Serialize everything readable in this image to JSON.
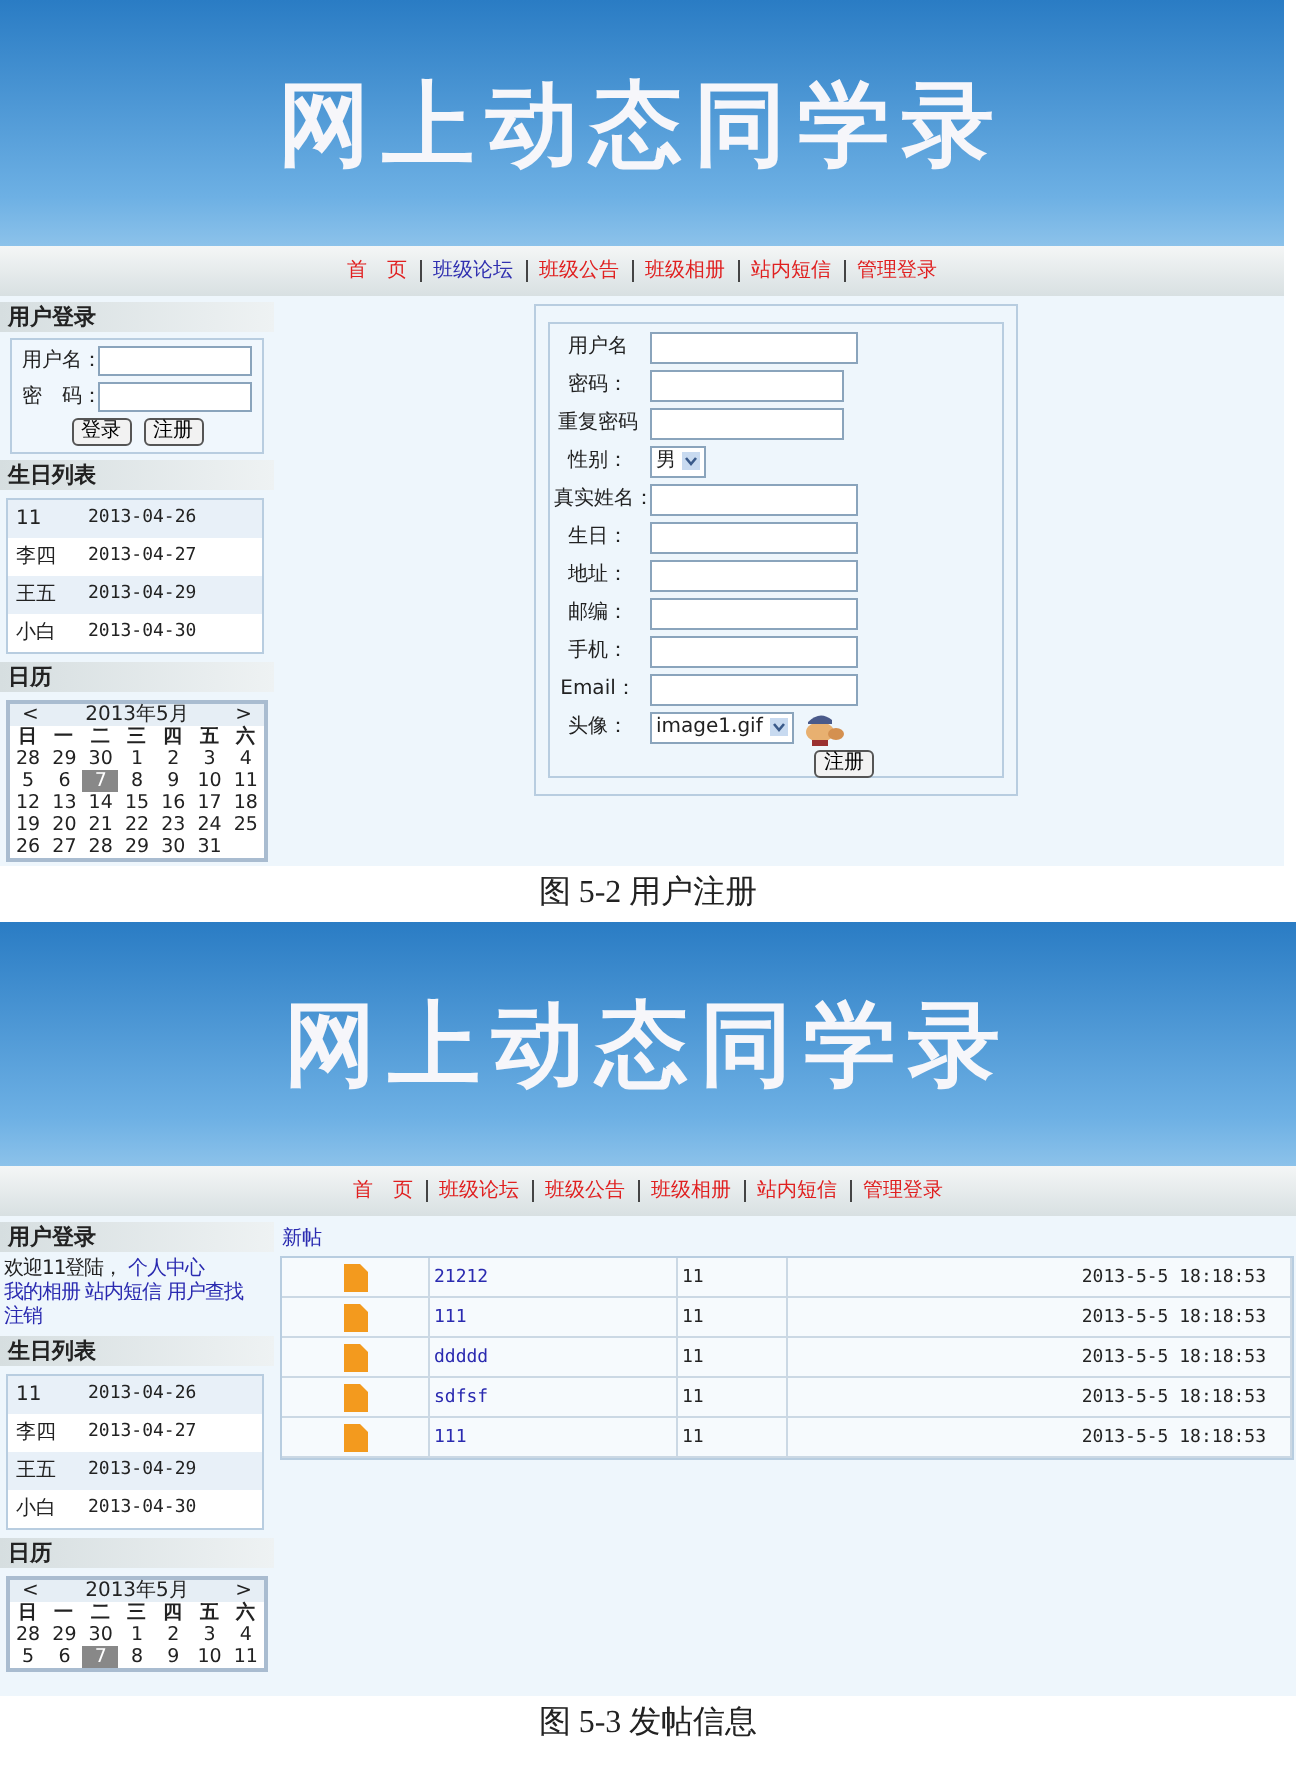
{
  "figures": [
    {
      "screenshot": {
        "banner_title": "网上动态同学录",
        "nav": [
          {
            "label": "首　页",
            "color": "#e02020"
          },
          {
            "label": "班级论坛",
            "color": "#3030b0"
          },
          {
            "label": "班级公告",
            "color": "#e02020"
          },
          {
            "label": "班级相册",
            "color": "#e02020"
          },
          {
            "label": "站内短信",
            "color": "#e02020"
          },
          {
            "label": "管理登录",
            "color": "#e02020"
          }
        ],
        "sidebar": {
          "login": {
            "kind": "form",
            "title": "用户登录",
            "fields": [
              {
                "label": "用户名："
              },
              {
                "label": "密　码："
              }
            ],
            "buttons": [
              "登录",
              "注册"
            ]
          },
          "birthdays": {
            "title": "生日列表",
            "rows": [
              {
                "name": "11",
                "date": "2013-04-26"
              },
              {
                "name": "李四",
                "date": "2013-04-27"
              },
              {
                "name": "王五",
                "date": "2013-04-29"
              },
              {
                "name": "小白",
                "date": "2013-04-30"
              }
            ]
          },
          "calendar": {
            "title": "日历",
            "prev": "<",
            "month": "2013年5月",
            "next": ">",
            "weekdays": [
              "日",
              "一",
              "二",
              "三",
              "四",
              "五",
              "六"
            ],
            "weeks": [
              [
                {
                  "day": "28",
                  "selected": false
                },
                {
                  "day": "29",
                  "selected": false
                },
                {
                  "day": "30",
                  "selected": false
                },
                {
                  "day": "1",
                  "selected": false
                },
                {
                  "day": "2",
                  "selected": false
                },
                {
                  "day": "3",
                  "selected": false
                },
                {
                  "day": "4",
                  "selected": false
                }
              ],
              [
                {
                  "day": "5",
                  "selected": false
                },
                {
                  "day": "6",
                  "selected": false
                },
                {
                  "day": "7",
                  "selected": true
                },
                {
                  "day": "8",
                  "selected": false
                },
                {
                  "day": "9",
                  "selected": false
                },
                {
                  "day": "10",
                  "selected": false
                },
                {
                  "day": "11",
                  "selected": false
                }
              ],
              [
                {
                  "day": "12",
                  "selected": false
                },
                {
                  "day": "13",
                  "selected": false
                },
                {
                  "day": "14",
                  "selected": false
                },
                {
                  "day": "15",
                  "selected": false
                },
                {
                  "day": "16",
                  "selected": false
                },
                {
                  "day": "17",
                  "selected": false
                },
                {
                  "day": "18",
                  "selected": false
                }
              ],
              [
                {
                  "day": "19",
                  "selected": false
                },
                {
                  "day": "20",
                  "selected": false
                },
                {
                  "day": "21",
                  "selected": false
                },
                {
                  "day": "22",
                  "selected": false
                },
                {
                  "day": "23",
                  "selected": false
                },
                {
                  "day": "24",
                  "selected": false
                },
                {
                  "day": "25",
                  "selected": false
                }
              ],
              [
                {
                  "day": "26",
                  "selected": false
                },
                {
                  "day": "27",
                  "selected": false
                },
                {
                  "day": "28",
                  "selected": false
                },
                {
                  "day": "29",
                  "selected": false
                },
                {
                  "day": "30",
                  "selected": false
                },
                {
                  "day": "31",
                  "selected": false
                }
              ]
            ]
          }
        },
        "main": {
          "kind": "register_form",
          "rows": [
            {
              "label": "用户名",
              "kind": "text"
            },
            {
              "label": "密码：",
              "kind": "short_text"
            },
            {
              "label": "重复密码",
              "kind": "short_text"
            },
            {
              "label": "性别：",
              "kind": "select",
              "value": "男"
            },
            {
              "label": "真实姓名：",
              "kind": "text"
            },
            {
              "label": "生日：",
              "kind": "text"
            },
            {
              "label": "地址：",
              "kind": "text"
            },
            {
              "label": "邮编：",
              "kind": "text"
            },
            {
              "label": "手机：",
              "kind": "text"
            },
            {
              "label": "Email：",
              "kind": "text"
            },
            {
              "label": "头像：",
              "kind": "avatar_select",
              "value": "image1.gif"
            }
          ],
          "submit": "注册"
        }
      },
      "caption": "图 5-2 用户注册"
    },
    {
      "screenshot": {
        "banner_title": "网上动态同学录",
        "nav": [
          {
            "label": "首　页",
            "color": "#e02020"
          },
          {
            "label": "班级论坛",
            "color": "#e02020"
          },
          {
            "label": "班级公告",
            "color": "#e02020"
          },
          {
            "label": "班级相册",
            "color": "#e02020"
          },
          {
            "label": "站内短信",
            "color": "#e02020"
          },
          {
            "label": "管理登录",
            "color": "#e02020"
          }
        ],
        "sidebar": {
          "login": {
            "kind": "logged_in",
            "title": "用户登录",
            "welcome": "欢迎11登陆，",
            "links": [
              "个人中心",
              "我的相册",
              "站内短信",
              "用户查找",
              "注销"
            ]
          },
          "birthdays": {
            "title": "生日列表",
            "rows": [
              {
                "name": "11",
                "date": "2013-04-26"
              },
              {
                "name": "李四",
                "date": "2013-04-27"
              },
              {
                "name": "王五",
                "date": "2013-04-29"
              },
              {
                "name": "小白",
                "date": "2013-04-30"
              }
            ]
          },
          "calendar": {
            "title": "日历",
            "prev": "<",
            "month": "2013年5月",
            "next": ">",
            "weekdays": [
              "日",
              "一",
              "二",
              "三",
              "四",
              "五",
              "六"
            ],
            "weeks": [
              [
                {
                  "day": "28",
                  "selected": false
                },
                {
                  "day": "29",
                  "selected": false
                },
                {
                  "day": "30",
                  "selected": false
                },
                {
                  "day": "1",
                  "selected": false
                },
                {
                  "day": "2",
                  "selected": false
                },
                {
                  "day": "3",
                  "selected": false
                },
                {
                  "day": "4",
                  "selected": false
                }
              ],
              [
                {
                  "day": "5",
                  "selected": false
                },
                {
                  "day": "6",
                  "selected": false
                },
                {
                  "day": "7",
                  "selected": true
                },
                {
                  "day": "8",
                  "selected": false
                },
                {
                  "day": "9",
                  "selected": false
                },
                {
                  "day": "10",
                  "selected": false
                },
                {
                  "day": "11",
                  "selected": false
                }
              ]
            ]
          }
        },
        "main": {
          "kind": "post_list",
          "title": "新帖",
          "rows": [
            {
              "title": "21212",
              "author": "11",
              "time": "2013-5-5 18:18:53"
            },
            {
              "title": "111",
              "author": "11",
              "time": "2013-5-5 18:18:53"
            },
            {
              "title": "ddddd",
              "author": "11",
              "time": "2013-5-5 18:18:53"
            },
            {
              "title": "sdfsf",
              "author": "11",
              "time": "2013-5-5 18:18:53"
            },
            {
              "title": "111",
              "author": "11",
              "time": "2013-5-5 18:18:53"
            }
          ]
        }
      },
      "caption": "图 5-3 发帖信息"
    }
  ]
}
